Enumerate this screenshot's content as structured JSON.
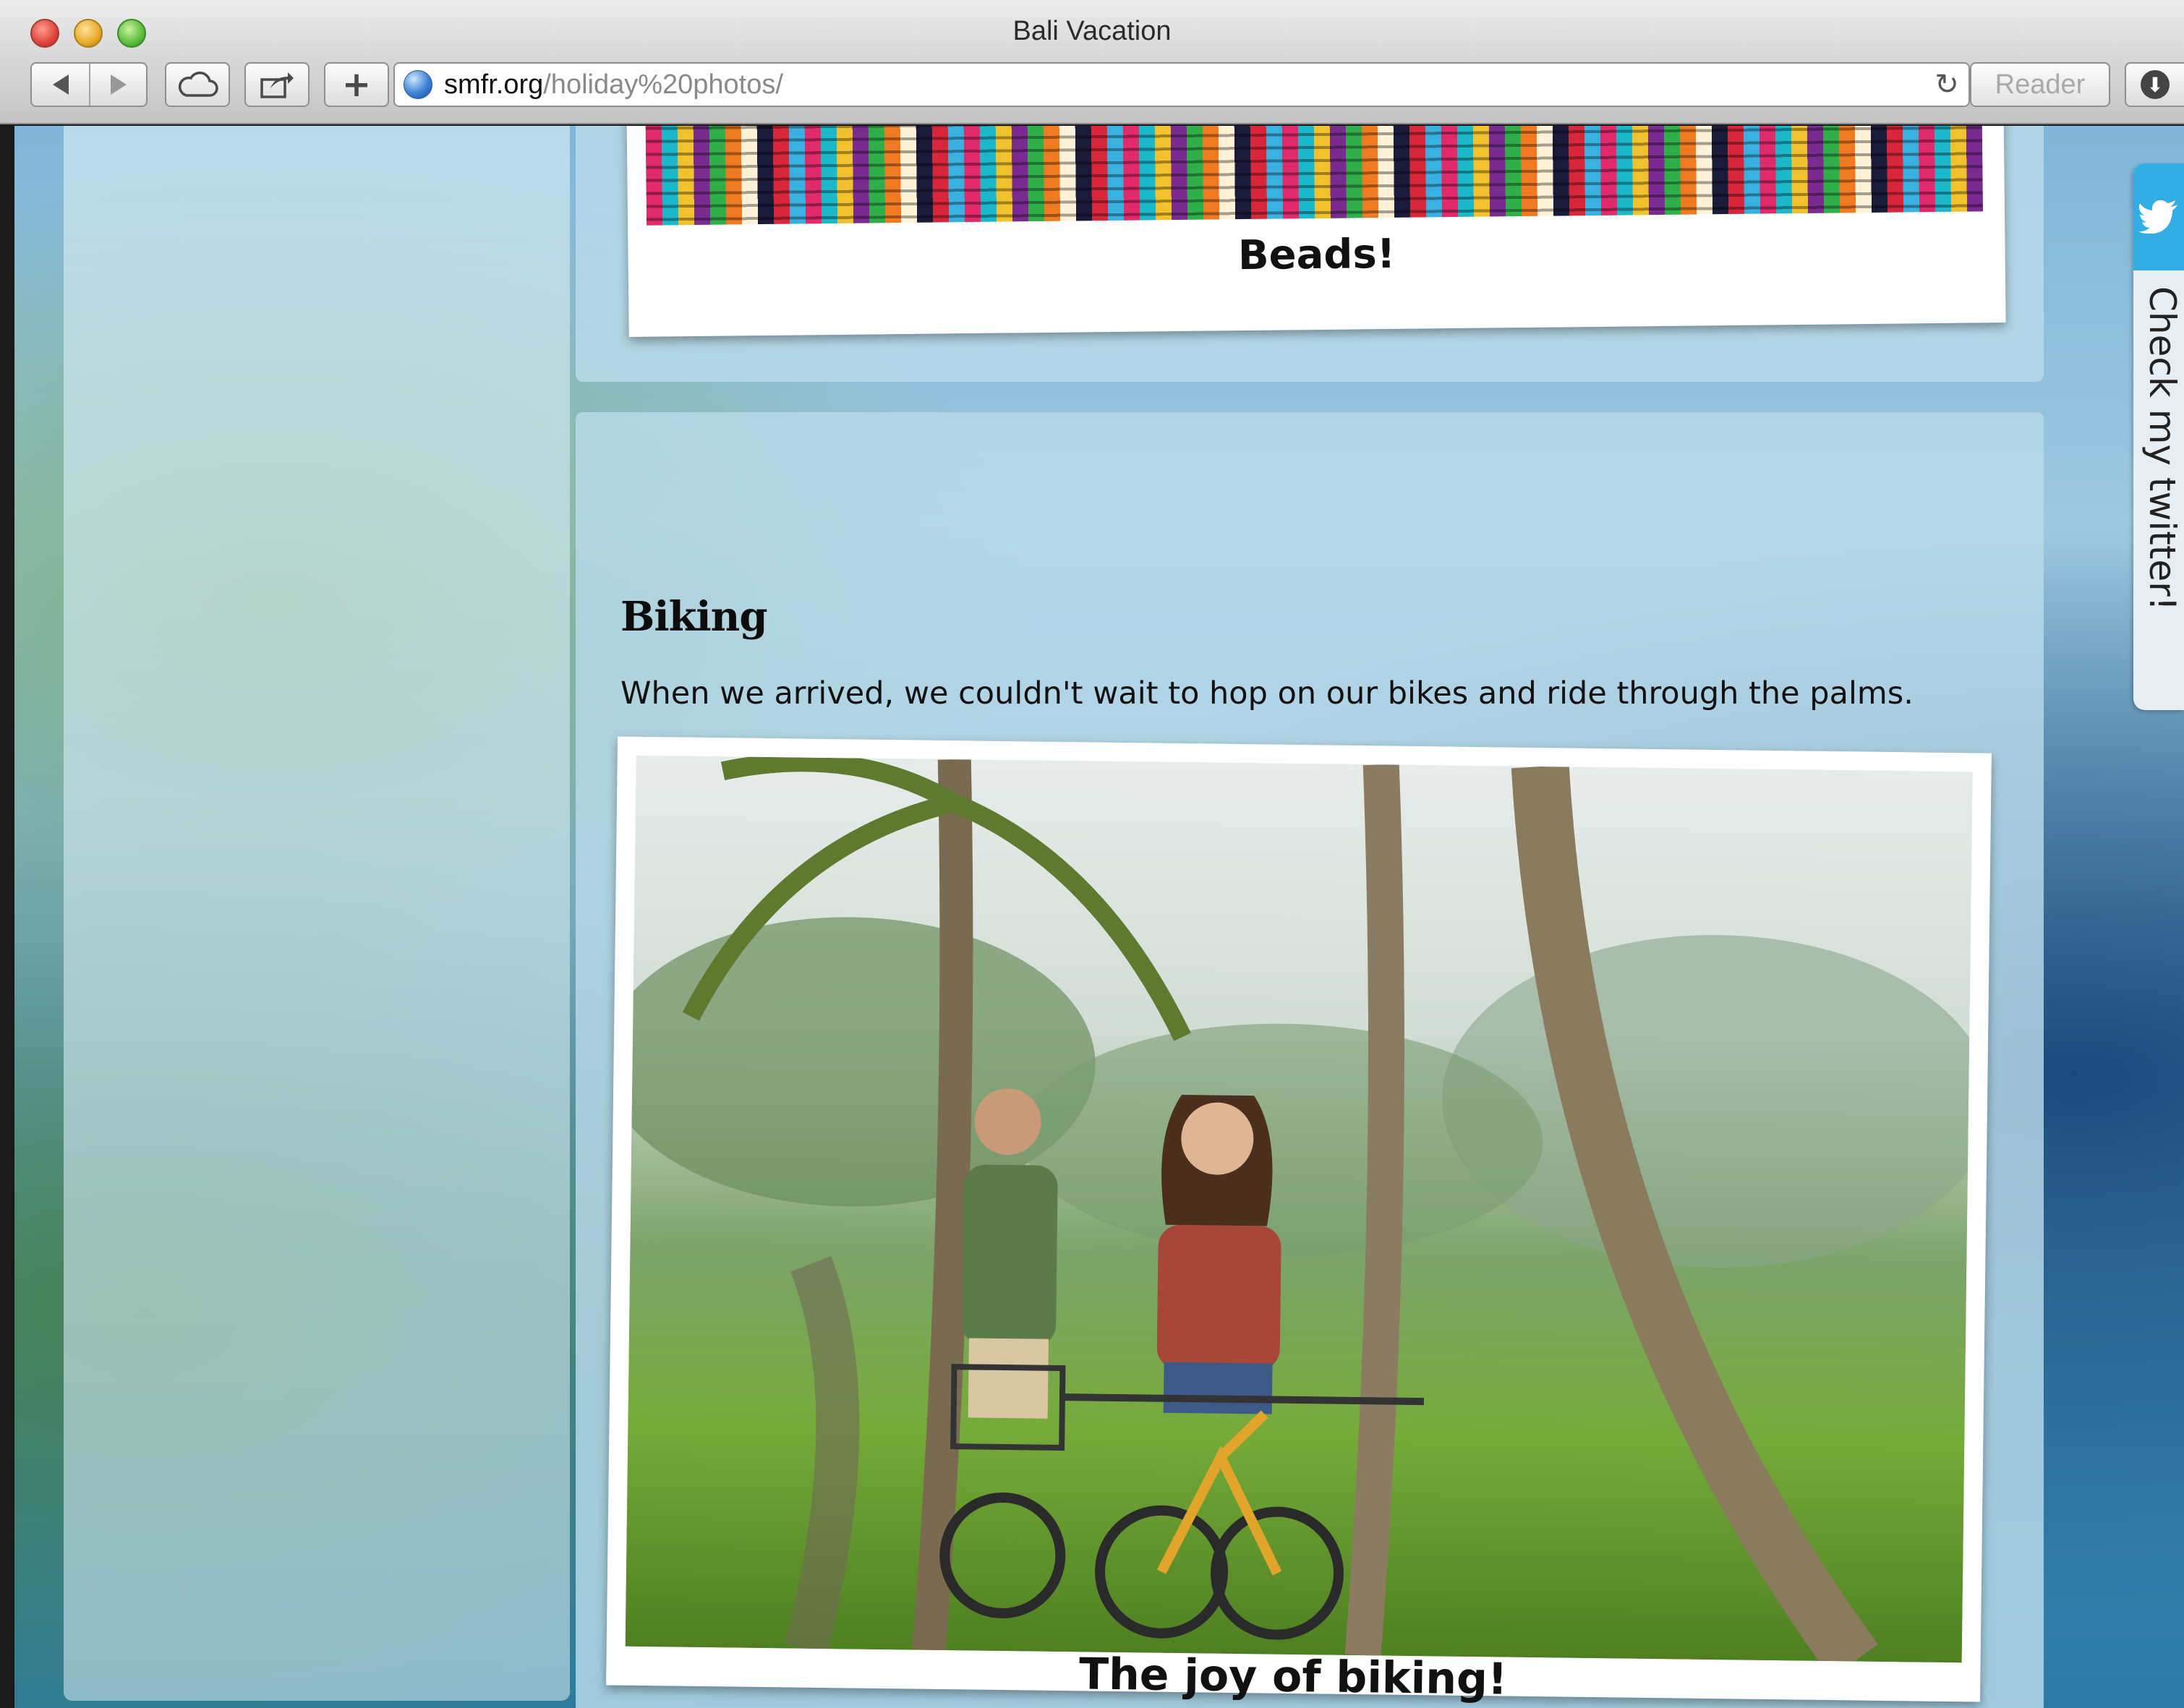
{
  "window": {
    "title": "Bali Vacation"
  },
  "toolbar": {
    "back_label": "Back",
    "forward_label": "Forward",
    "reader_label": "Reader"
  },
  "address_bar": {
    "host": "smfr.org",
    "path": "/holiday%20photos/"
  },
  "sections": {
    "beads": {
      "caption": "Beads!"
    },
    "biking": {
      "title": "Biking",
      "text": "When we arrived, we couldn't wait to hop on our bikes and ride through the palms.",
      "caption": "The joy of biking!"
    }
  },
  "twitter": {
    "label": "Check my twitter!"
  },
  "colors": {
    "twitter_blue": "#33aee4",
    "card_bg": "#b9dae9"
  }
}
